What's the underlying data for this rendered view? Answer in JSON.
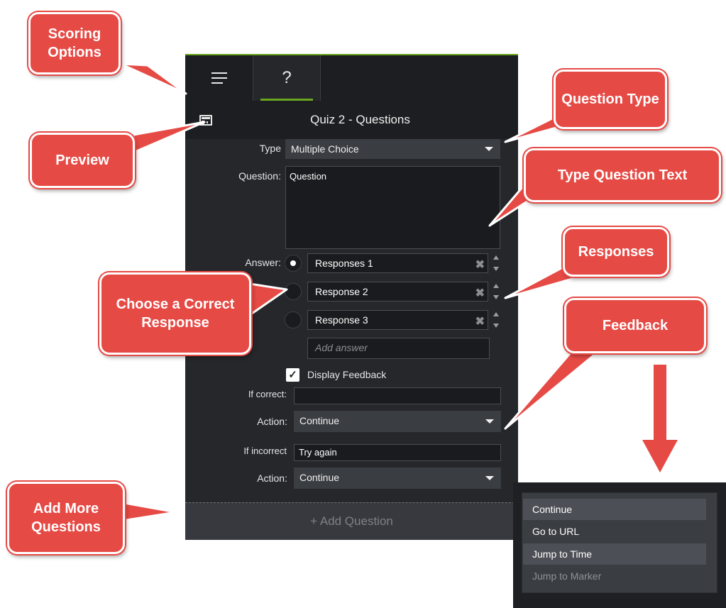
{
  "panel": {
    "title": "Quiz 2 - Questions",
    "tab_question_glyph": "?",
    "icons": {
      "options": "hamburger-menu-icon",
      "preview": "preview-list-icon"
    }
  },
  "form": {
    "type_label": "Type",
    "type_value": "Multiple Choice",
    "question_label": "Question:",
    "question_value": "Question",
    "answer_label": "Answer:",
    "responses": [
      "Responses 1",
      "Response 2",
      "Response 3"
    ],
    "selected_response": 0,
    "add_answer_placeholder": "Add answer",
    "display_feedback_label": "Display Feedback",
    "display_feedback_checked": true,
    "if_correct_label": "If correct:",
    "if_correct_value": "",
    "action_label": "Action:",
    "action_correct_value": "Continue",
    "if_incorrect_label": "If incorrect",
    "if_incorrect_value": "Try again",
    "action_incorrect_value": "Continue",
    "add_question_label": "+ Add Question"
  },
  "action_menu": {
    "items": [
      "Continue",
      "Go to URL",
      "Jump to Time",
      "Jump to Marker"
    ],
    "highlighted": [
      0,
      2
    ],
    "disabled": [
      3
    ]
  },
  "callouts": {
    "scoring_options": "Scoring Options",
    "preview": "Preview",
    "question_type": "Question Type",
    "type_question_text": "Type Question Text",
    "responses": "Responses",
    "choose_correct": "Choose a Correct Response",
    "feedback": "Feedback",
    "add_more": "Add More Questions"
  },
  "colors": {
    "callout": "#e64a45",
    "accent": "#6aa51f",
    "panel_bg": "#25272b"
  }
}
